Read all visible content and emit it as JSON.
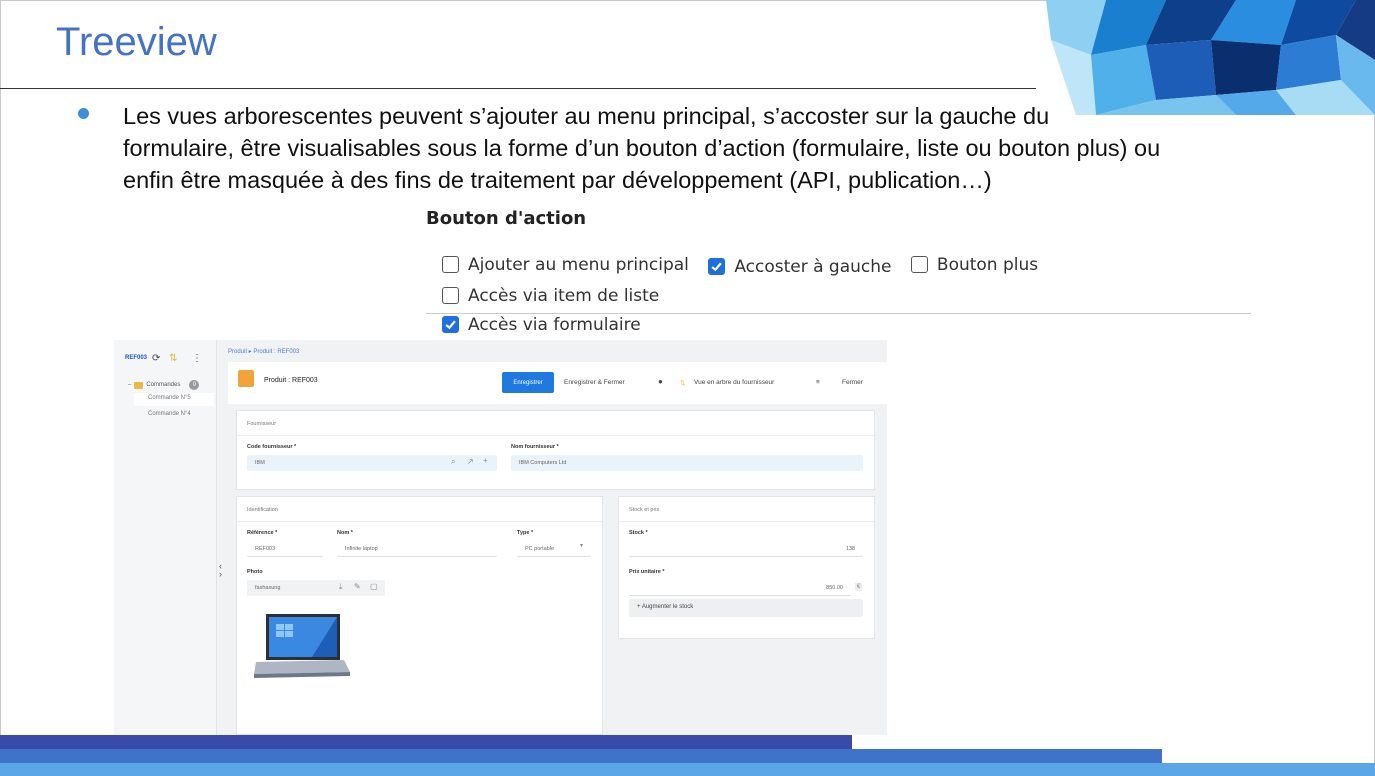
{
  "slide": {
    "title": "Treeview",
    "bullet": "Les vues arborescentes peuvent s’ajouter au menu principal, s’accoster sur la gauche du formulaire, être visualisables sous la forme d’un bouton d’action (formulaire, liste ou bouton plus) ou enfin être masquée  à des fins de traitement par développement (API, publication…)"
  },
  "bouton_action": {
    "title": "Bouton d'action",
    "options": [
      {
        "label": "Ajouter au menu principal",
        "checked": false
      },
      {
        "label": "Accoster à gauche",
        "checked": true
      },
      {
        "label": "Bouton plus",
        "checked": false
      },
      {
        "label": "Accès via item de liste",
        "checked": false
      },
      {
        "label": "Accès via formulaire",
        "checked": true
      }
    ]
  },
  "app": {
    "sidebar": {
      "ref": "REF003",
      "tree_root": "Commandes",
      "tree_count": "0",
      "children": [
        "Commande N°5",
        "Commande N°4"
      ]
    },
    "breadcrumb": "Produit  ▸  Produit : REF003",
    "header": {
      "title": "Produit : REF003",
      "save": "Enregistrer",
      "save_close": "Enregistrer & Fermer",
      "tree_view": "Vue en arbre du fournisseur",
      "close": "Fermer"
    },
    "fournisseur": {
      "section": "Fournisseur",
      "code_label": "Code fournisseur *",
      "code_value": "IBM",
      "name_label": "Nom fournisseur *",
      "name_value": "IBM Computers Ltd"
    },
    "identification": {
      "section": "Identification",
      "ref_label": "Référence *",
      "ref_value": "REF003",
      "nom_label": "Nom *",
      "nom_value": "Infinite laptop",
      "type_label": "Type *",
      "type_value": "PC portable",
      "photo_label": "Photo",
      "photo_value": "fashasung"
    },
    "stock": {
      "section": "Stock et prix",
      "stock_label": "Stock *",
      "stock_value": "138",
      "prix_label": "Prix unitaire *",
      "prix_value": "850.00",
      "currency": "€",
      "augment": "Augmenter le stock"
    }
  },
  "colors": {
    "title": "#4472c4",
    "bullet": "#3b8fd9",
    "checkbox": "#1f6fe0",
    "bar1": "#3b4aa8",
    "bar2": "#3f73c9",
    "bar3": "#5aa6e6"
  }
}
